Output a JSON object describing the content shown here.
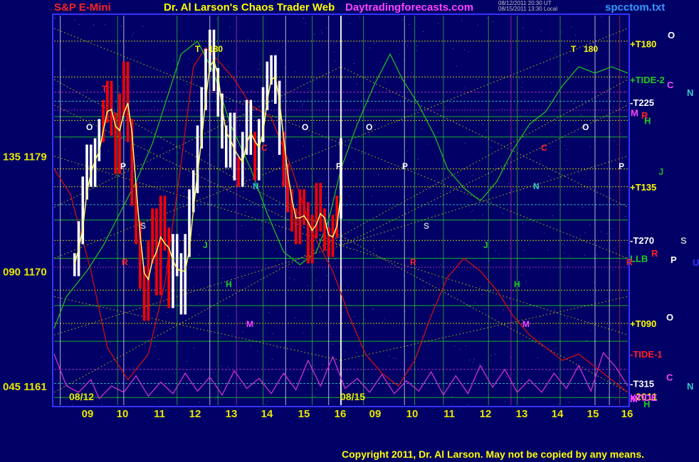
{
  "header": {
    "instrument": "S&P E-Mini",
    "title": "Dr. Al Larson's Chaos Trader Web",
    "site": "Daytradingforecasts.com",
    "stamp_line1": "08/12/2011 20:30 UT",
    "stamp_line2": "08/15/2011 13:30 Local",
    "file": "spcctom.txt"
  },
  "copyright": "Copyright 2011, Dr. Al Larson. May not be copied by any means.",
  "colors": {
    "background": "#000066",
    "grid_green": "#22cc22",
    "grid_yellow": "#e8e800",
    "grid_magenta": "#cc33cc",
    "grid_cyan": "#33cccc",
    "price_white": "#ffffff",
    "price_red": "#ff0000",
    "average_yellow": "#ffff66",
    "tide_green": "#22bb22",
    "tide_red": "#cc1111",
    "xtide_magenta": "#cc33cc",
    "axis_blue": "#3333ff"
  },
  "chart_data": {
    "type": "line",
    "title": "S&P E-Mini",
    "y_axis": {
      "ticks": [
        {
          "angle": "135",
          "price": "1179",
          "value": 1179
        },
        {
          "angle": "090",
          "price": "1170",
          "value": 1170
        },
        {
          "angle": "045",
          "price": "1161",
          "value": 1161
        }
      ],
      "range": [
        1159.5,
        1190
      ]
    },
    "x_axis": {
      "day1_label": "08/12",
      "day2_label": "08/15",
      "year_label": "2011",
      "hours_day1": [
        "09",
        "10",
        "11",
        "12",
        "13",
        "14",
        "15",
        "16"
      ],
      "hours_day2": [
        "09",
        "10",
        "11",
        "12",
        "13",
        "14",
        "15",
        "16"
      ]
    },
    "right_labels": [
      {
        "text": "+T180",
        "color": "#ffff00",
        "value": 1187.8
      },
      {
        "text": "+TIDE-2",
        "color": "#22cc22",
        "value": 1185.0
      },
      {
        "text": "-T225",
        "color": "#ffffff",
        "value": 1183.2
      },
      {
        "text": "+T135",
        "color": "#ffff00",
        "value": 1176.6
      },
      {
        "text": "-T270",
        "color": "#ffffff",
        "value": 1172.4
      },
      {
        "text": "LLB",
        "color": "#22cc22",
        "value": 1171.0
      },
      {
        "text": "+T090",
        "color": "#ffff00",
        "value": 1165.9
      },
      {
        "text": "-TIDE-1",
        "color": "#ff2222",
        "value": 1163.5
      },
      {
        "text": "-T315",
        "color": "#ffffff",
        "value": 1161.2
      },
      {
        "text": "XTIDE",
        "color": "#ff44ff",
        "value": 1160.1
      }
    ],
    "planet_labels": [
      {
        "text": "O",
        "color": "#ffffff",
        "value": 1188.5
      },
      {
        "text": "C",
        "color": "#ff44ff",
        "value": 1184.6
      },
      {
        "text": "N",
        "color": "#33cccc",
        "value": 1184.0
      },
      {
        "text": "M",
        "color": "#ff44ff",
        "value": 1182.4
      },
      {
        "text": "R",
        "color": "#ff2222",
        "value": 1182.2
      },
      {
        "text": "H",
        "color": "#22cc22",
        "value": 1181.8
      },
      {
        "text": "J",
        "color": "#22aa22",
        "value": 1177.8
      },
      {
        "text": "S",
        "color": "#c0c0c0",
        "value": 1172.4
      },
      {
        "text": "P",
        "color": "#ffffff",
        "value": 1170.9
      },
      {
        "text": "R",
        "color": "#ff2222",
        "value": 1171.4
      },
      {
        "text": "U",
        "color": "#3333ff",
        "value": 1170.7
      },
      {
        "text": "O",
        "color": "#ffffff",
        "value": 1166.4
      },
      {
        "text": "C",
        "color": "#ff44ff",
        "value": 1161.7
      },
      {
        "text": "N",
        "color": "#33cccc",
        "value": 1161.0
      },
      {
        "text": "M",
        "color": "#ff44ff",
        "value": 1160.0
      },
      {
        "text": "H",
        "color": "#22cc22",
        "value": 1159.6
      }
    ],
    "event_labels": [
      {
        "text": "T",
        "color": "#ffff00"
      },
      {
        "text": "180",
        "color": "#ffff00"
      },
      {
        "text": "T",
        "color": "#ffff00"
      },
      {
        "text": "180",
        "color": "#ffff00"
      },
      {
        "text": "O",
        "color": "#ffffff"
      },
      {
        "text": "O",
        "color": "#ffffff"
      },
      {
        "text": "O",
        "color": "#ffffff"
      },
      {
        "text": "O",
        "color": "#ffffff"
      },
      {
        "text": "P",
        "color": "#ffffff"
      },
      {
        "text": "P",
        "color": "#ffffff"
      },
      {
        "text": "P",
        "color": "#ffffff"
      },
      {
        "text": "P",
        "color": "#ffffff"
      },
      {
        "text": "S",
        "color": "#c0c0c0"
      },
      {
        "text": "S",
        "color": "#c0c0c0"
      },
      {
        "text": "N",
        "color": "#33cccc"
      },
      {
        "text": "N",
        "color": "#33cccc"
      },
      {
        "text": "C",
        "color": "#ff2222"
      },
      {
        "text": "C",
        "color": "#ff2222"
      },
      {
        "text": "J",
        "color": "#22cc22"
      },
      {
        "text": "J",
        "color": "#22cc22"
      },
      {
        "text": "H",
        "color": "#22cc22"
      },
      {
        "text": "H",
        "color": "#22cc22"
      },
      {
        "text": "M",
        "color": "#ff44ff"
      },
      {
        "text": "M",
        "color": "#ff44ff"
      },
      {
        "text": "R",
        "color": "#ff2222"
      },
      {
        "text": "R",
        "color": "#ff2222"
      },
      {
        "text": "R",
        "color": "#ff2222"
      },
      {
        "text": "T",
        "color": "#ff2222"
      }
    ],
    "price_series": {
      "name": "S&P E-Mini",
      "x_hours": [
        9.5,
        9.6,
        9.7,
        9.8,
        9.9,
        10.0,
        10.1,
        10.2,
        10.3,
        10.4,
        10.5,
        10.6,
        10.7,
        10.8,
        10.9,
        11.0,
        11.1,
        11.2,
        11.3,
        11.4,
        11.5,
        11.6,
        11.7,
        11.8,
        11.9,
        12.0,
        12.1,
        12.2,
        12.3,
        12.4,
        12.5,
        12.6,
        12.7,
        12.8,
        12.9,
        13.0,
        13.1,
        13.2,
        13.3,
        13.4,
        13.5,
        13.6,
        13.7,
        13.8,
        13.9,
        14.0,
        14.1,
        14.2,
        14.3,
        14.4,
        14.5,
        14.6,
        14.7,
        14.8,
        14.9,
        15.0,
        15.1,
        15.2,
        15.3,
        15.4,
        15.5,
        15.6,
        15.7,
        15.8,
        15.9,
        16.0
      ],
      "values": [
        1170.5,
        1173.0,
        1176.5,
        1179.0,
        1177.5,
        1179.5,
        1181.0,
        1182.5,
        1184.0,
        1181.5,
        1178.5,
        1183.0,
        1185.5,
        1181.0,
        1176.0,
        1173.0,
        1169.5,
        1167.0,
        1171.5,
        1174.0,
        1169.0,
        1175.0,
        1172.5,
        1168.0,
        1172.0,
        1170.5,
        1167.5,
        1172.0,
        1175.5,
        1177.0,
        1180.5,
        1183.5,
        1186.5,
        1188.0,
        1185.0,
        1183.0,
        1180.5,
        1179.0,
        1181.5,
        1178.0,
        1177.5,
        1180.0,
        1182.5,
        1180.0,
        1178.0,
        1181.0,
        1183.5,
        1185.5,
        1186.0,
        1184.0,
        1180.0,
        1177.5,
        1175.5,
        1174.0,
        1173.0,
        1175.5,
        1174.5,
        1171.5,
        1173.5,
        1176.0,
        1174.0,
        1172.5,
        1172.0,
        1173.5,
        1175.0,
        1179.5
      ]
    },
    "tide_green": {
      "name": "+TIDE-2",
      "points": [
        [
          9.0,
          1165.5
        ],
        [
          9.3,
          1168.0
        ],
        [
          9.8,
          1170.0
        ],
        [
          10.2,
          1172.0
        ],
        [
          10.6,
          1174.5
        ],
        [
          11.0,
          1177.0
        ],
        [
          11.4,
          1180.0
        ],
        [
          11.8,
          1184.0
        ],
        [
          12.1,
          1187.0
        ],
        [
          12.5,
          1188.0
        ],
        [
          12.9,
          1185.5
        ],
        [
          13.3,
          1181.5
        ],
        [
          13.8,
          1178.0
        ],
        [
          14.2,
          1174.5
        ],
        [
          14.6,
          1171.5
        ],
        [
          15.0,
          1170.5
        ],
        [
          15.4,
          1171.5
        ],
        [
          15.7,
          1174.0
        ],
        [
          16.0,
          1178.0
        ],
        [
          16.4,
          1181.5
        ],
        [
          16.8,
          1184.5
        ],
        [
          17.2,
          1187.0
        ],
        [
          17.5,
          1185.0
        ],
        [
          17.9,
          1183.0
        ],
        [
          18.3,
          1180.5
        ],
        [
          18.6,
          1178.0
        ],
        [
          19.0,
          1176.5
        ],
        [
          19.4,
          1175.5
        ],
        [
          19.8,
          1177.0
        ],
        [
          20.2,
          1179.5
        ],
        [
          20.6,
          1181.5
        ],
        [
          21.0,
          1182.5
        ],
        [
          21.4,
          1184.5
        ],
        [
          21.8,
          1186.0
        ],
        [
          22.2,
          1185.5
        ],
        [
          22.6,
          1186.0
        ],
        [
          23.0,
          1185.5
        ]
      ]
    },
    "tide_red": {
      "name": "-TIDE-1",
      "points": [
        [
          9.0,
          1178.0
        ],
        [
          9.4,
          1176.0
        ],
        [
          9.9,
          1170.0
        ],
        [
          10.3,
          1164.0
        ],
        [
          10.8,
          1161.5
        ],
        [
          11.3,
          1163.5
        ],
        [
          11.7,
          1169.0
        ],
        [
          12.1,
          1178.5
        ],
        [
          12.4,
          1186.0
        ],
        [
          12.7,
          1187.5
        ],
        [
          13.0,
          1186.5
        ],
        [
          13.4,
          1185.0
        ],
        [
          13.8,
          1183.0
        ],
        [
          14.3,
          1182.0
        ],
        [
          14.8,
          1178.0
        ],
        [
          15.3,
          1173.0
        ],
        [
          15.8,
          1170.0
        ],
        [
          16.2,
          1166.5
        ],
        [
          16.6,
          1163.5
        ],
        [
          17.0,
          1162.0
        ],
        [
          17.4,
          1161.0
        ],
        [
          17.8,
          1163.0
        ],
        [
          18.2,
          1166.5
        ],
        [
          18.6,
          1169.5
        ],
        [
          19.0,
          1171.0
        ],
        [
          19.4,
          1170.0
        ],
        [
          19.8,
          1168.5
        ],
        [
          20.2,
          1166.5
        ],
        [
          20.6,
          1165.0
        ],
        [
          21.0,
          1164.0
        ],
        [
          21.4,
          1163.0
        ],
        [
          21.8,
          1163.5
        ],
        [
          22.2,
          1162.5
        ],
        [
          22.6,
          1161.5
        ],
        [
          23.0,
          1160.5
        ]
      ]
    },
    "xtide": {
      "name": "XTIDE",
      "points": [
        [
          9.0,
          1163.5
        ],
        [
          9.3,
          1161.0
        ],
        [
          9.6,
          1160.5
        ],
        [
          9.9,
          1161.5
        ],
        [
          10.1,
          1160.0
        ],
        [
          10.4,
          1161.0
        ],
        [
          10.7,
          1160.5
        ],
        [
          11.0,
          1161.8
        ],
        [
          11.3,
          1160.2
        ],
        [
          11.6,
          1161.3
        ],
        [
          11.9,
          1160.4
        ],
        [
          12.2,
          1162.0
        ],
        [
          12.5,
          1160.6
        ],
        [
          12.8,
          1161.7
        ],
        [
          13.1,
          1160.3
        ],
        [
          13.4,
          1162.2
        ],
        [
          13.7,
          1160.8
        ],
        [
          14.0,
          1161.6
        ],
        [
          14.3,
          1160.4
        ],
        [
          14.6,
          1162.0
        ],
        [
          14.9,
          1160.7
        ],
        [
          15.2,
          1163.0
        ],
        [
          15.5,
          1161.0
        ],
        [
          15.8,
          1163.3
        ],
        [
          16.1,
          1160.8
        ],
        [
          16.4,
          1161.6
        ],
        [
          16.7,
          1160.5
        ],
        [
          17.0,
          1161.9
        ],
        [
          17.3,
          1160.4
        ],
        [
          17.6,
          1161.4
        ],
        [
          17.9,
          1160.6
        ],
        [
          18.2,
          1162.1
        ],
        [
          18.5,
          1160.3
        ],
        [
          18.8,
          1161.8
        ],
        [
          19.1,
          1160.4
        ],
        [
          19.4,
          1162.6
        ],
        [
          19.7,
          1160.9
        ],
        [
          20.0,
          1162.3
        ],
        [
          20.3,
          1160.5
        ],
        [
          20.6,
          1161.5
        ],
        [
          20.9,
          1160.5
        ],
        [
          21.2,
          1162.0
        ],
        [
          21.5,
          1160.8
        ],
        [
          21.8,
          1162.6
        ],
        [
          22.1,
          1160.6
        ],
        [
          22.4,
          1163.6
        ],
        [
          22.7,
          1162.5
        ],
        [
          23.0,
          1161.0
        ]
      ]
    }
  }
}
